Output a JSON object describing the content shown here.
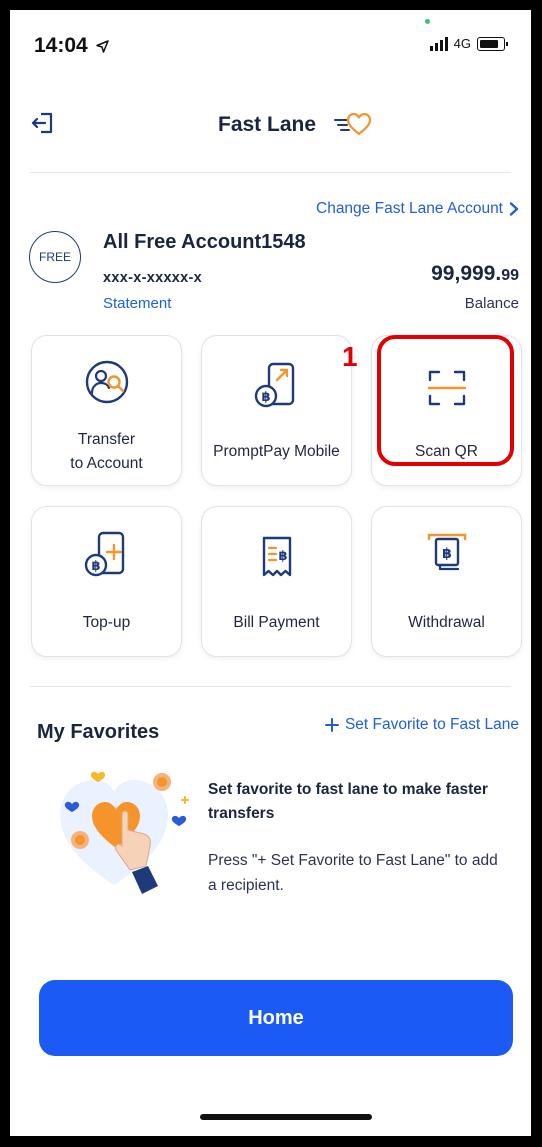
{
  "status": {
    "time": "14:04",
    "network": "4G"
  },
  "header": {
    "title": "Fast Lane"
  },
  "account": {
    "change_link": "Change Fast Lane Account",
    "badge": "FREE",
    "name": "All Free Account1548",
    "number": "xxx-x-xxxxx-x",
    "statement": "Statement",
    "balance_int": "99,999.",
    "balance_dec": "99",
    "balance_label": "Balance"
  },
  "menu": {
    "transfer": {
      "line1": "Transfer",
      "line2": "to Account"
    },
    "promptpay": "PromptPay Mobile",
    "scanqr": "Scan QR",
    "topup": "Top-up",
    "bill": "Bill Payment",
    "withdrawal": "Withdrawal"
  },
  "annotation": {
    "number": "1"
  },
  "favorites": {
    "title": "My Favorites",
    "set_link": "Set Favorite to Fast Lane",
    "heading": "Set favorite to fast lane to make faster transfers",
    "description": "Press \"+ Set Favorite to Fast Lane\" to add a recipient."
  },
  "footer": {
    "home_label": "Home"
  },
  "colors": {
    "accent": "#1c5af5",
    "link": "#1f5fd8",
    "icon": "#1f3a7a",
    "highlight": "#f5942a",
    "annotation": "#e20000"
  }
}
